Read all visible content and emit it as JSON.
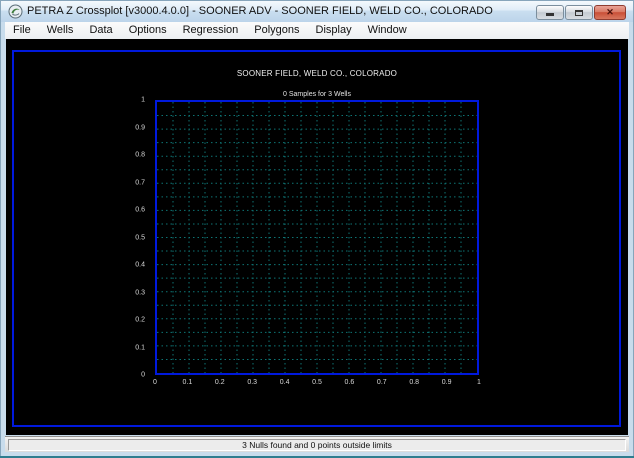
{
  "window": {
    "title": "PETRA Z Crossplot [v3000.4.0.0] - SOONER ADV - SOONER FIELD, WELD CO., COLORADO"
  },
  "menu": {
    "items": [
      "File",
      "Wells",
      "Data",
      "Options",
      "Regression",
      "Polygons",
      "Display",
      "Window"
    ]
  },
  "chart_data": {
    "type": "scatter",
    "title": "SOONER FIELD, WELD CO., COLORADO",
    "subtitle": "0 Samples for 3 Wells",
    "points": [],
    "xlim": [
      0,
      1
    ],
    "ylim": [
      0,
      1
    ],
    "x_tick_labels": [
      "0",
      "0.1",
      "0.2",
      "0.3",
      "0.4",
      "0.5",
      "0.6",
      "0.7",
      "0.8",
      "0.9",
      "1"
    ],
    "y_tick_labels": [
      "1",
      "0.9",
      "0.8",
      "0.7",
      "0.6",
      "0.5",
      "0.4",
      "0.3",
      "0.2",
      "0.1",
      "0"
    ],
    "minor_grid_step": 0.05,
    "grid": "dotted",
    "legend": false,
    "colors": {
      "plot_border": "#0019dd",
      "grid": "#0e7474",
      "background": "#000000",
      "text": "#e6e6e6"
    }
  },
  "status_bar": {
    "text": "3 Nulls found and 0 points outside limits"
  }
}
